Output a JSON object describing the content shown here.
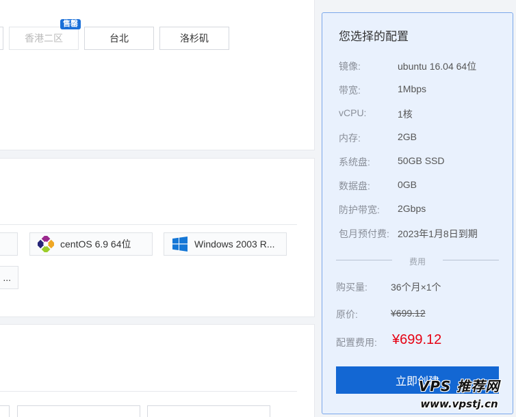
{
  "region": {
    "sold_out_badge": "售罄",
    "options": [
      {
        "label": "",
        "disabled": false
      },
      {
        "label": "香港二区",
        "disabled": true
      },
      {
        "label": "台北",
        "disabled": false
      },
      {
        "label": "洛杉矶",
        "disabled": false
      }
    ]
  },
  "image": {
    "options": [
      {
        "label": "centOS 6.9 64位",
        "icon": "centos-icon"
      },
      {
        "label": "Windows 2003 R...",
        "icon": "windows-icon"
      },
      {
        "label": "...",
        "icon": ""
      }
    ]
  },
  "summary": {
    "title": "您选择的配置",
    "rows": [
      {
        "label": "镜像:",
        "value": "ubuntu 16.04 64位"
      },
      {
        "label": "带宽:",
        "value": "1Mbps"
      },
      {
        "label": "vCPU:",
        "value": "1核"
      },
      {
        "label": "内存:",
        "value": "2GB"
      },
      {
        "label": "系统盘:",
        "value": "50GB SSD"
      },
      {
        "label": "数据盘:",
        "value": "0GB"
      },
      {
        "label": "防护带宽:",
        "value": "2Gbps"
      },
      {
        "label": "包月预付费:",
        "value": "2023年1月8日到期"
      }
    ],
    "fee_section_label": "费用",
    "quantity_label": "购买量:",
    "quantity_value": "36个月×1个",
    "original_label": "原价:",
    "original_value": "¥699.12",
    "config_fee_label": "配置费用:",
    "config_fee_value": "¥699.12",
    "create_button": "立即创建"
  },
  "watermark": {
    "line1": "VPS 推荐网",
    "line2": "www.vpstj.cn"
  },
  "colors": {
    "accent": "#1367d3",
    "price": "#e60012",
    "panel_bg": "#e9f1fd",
    "panel_border": "#7aa7ea"
  }
}
